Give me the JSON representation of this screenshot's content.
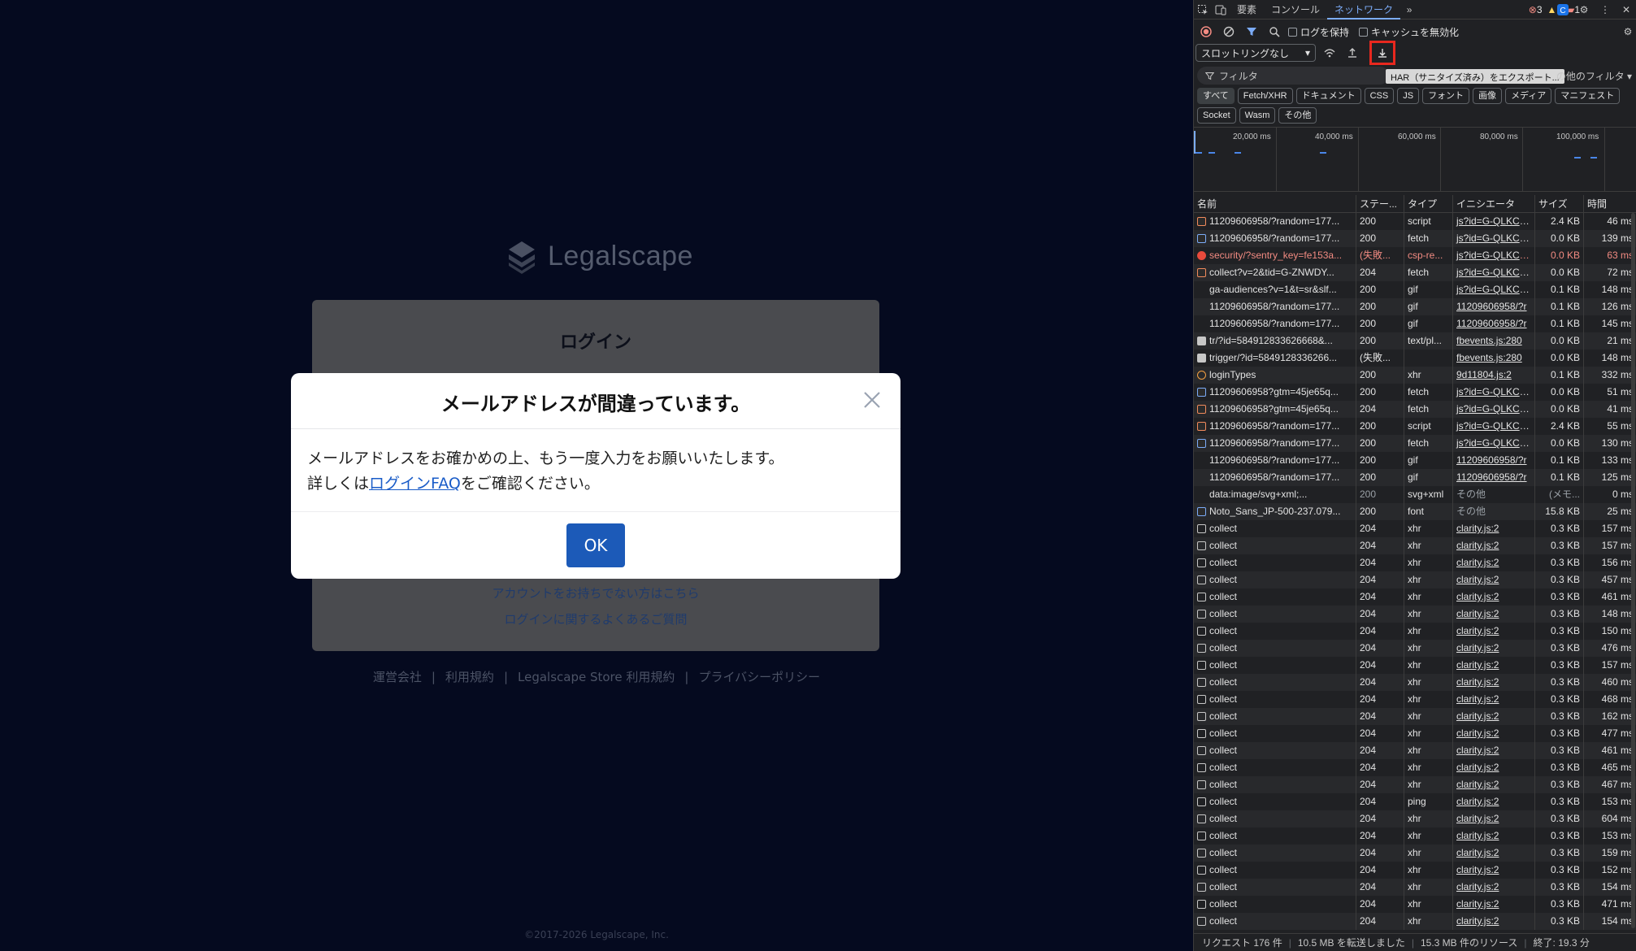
{
  "page": {
    "logo_text": "Legalscape",
    "login_title": "ログイン",
    "link_no_account": "アカウントをお持ちでない方はこちら",
    "link_login_faq": "ログインに関するよくあるご質問",
    "footer_links": [
      "運営会社",
      "利用規約",
      "Legalscape Store 利用規約",
      "プライバシーポリシー"
    ],
    "copyright": "©2017-2026 Legalscape, Inc."
  },
  "modal": {
    "title": "メールアドレスが間違っています。",
    "line1": "メールアドレスをお確かめの上、もう一度入力をお願いいたします。",
    "line2_prefix": "詳しくは",
    "line2_link": "ログインFAQ",
    "line2_suffix": "をご確認ください。",
    "ok_label": "OK"
  },
  "devtools": {
    "tabs": [
      "要素",
      "コンソール",
      "ネットワーク"
    ],
    "active_tab": "ネットワーク",
    "errors": "3",
    "warnings": "1",
    "issues": "1",
    "preserve_log": "ログを保持",
    "disable_cache": "キャッシュを無効化",
    "throttling": "スロットリングなし",
    "filter_placeholder": "フィルタ",
    "tooltip": "HAR（サニタイズ済み）をエクスポート...",
    "more_filters": "の他のフィルタ",
    "type_filters": [
      "すべて",
      "Fetch/XHR",
      "ドキュメント",
      "CSS",
      "JS",
      "フォント",
      "画像",
      "メディア",
      "マニフェスト",
      "Socket",
      "Wasm",
      "その他"
    ],
    "overview_labels": [
      "20,000 ms",
      "40,000 ms",
      "60,000 ms",
      "80,000 ms",
      "100,000 ms"
    ],
    "columns": [
      "名前",
      "ステー...",
      "タイプ",
      "イニシエータ",
      "サイズ",
      "時間"
    ],
    "status_bar": [
      "リクエスト 176 件",
      "10.5 MB を転送しました",
      "15.3 MB 件のリソース",
      "終了: 19.3 分"
    ],
    "accent_color": "#7cacf8",
    "highlight_color": "#e8281e"
  },
  "requests": [
    {
      "name": "11209606958/?random=177...",
      "status": "200",
      "type": "script",
      "initiator": "js?id=G-QLKCPG",
      "size": "2.4 KB",
      "time": "46 ms",
      "icon": "script"
    },
    {
      "name": "11209606958/?random=177...",
      "status": "200",
      "type": "fetch",
      "initiator": "js?id=G-QLKCPG",
      "size": "0.0 KB",
      "time": "139 ms",
      "icon": "fetch"
    },
    {
      "name": "security/?sentry_key=fe153a...",
      "status": "(失敗...",
      "type": "csp-re...",
      "initiator": "js?id=G-QLKCPG",
      "size": "0.0 KB",
      "time": "63 ms",
      "icon": "error"
    },
    {
      "name": "collect?v=2&tid=G-ZNWDY...",
      "status": "204",
      "type": "fetch",
      "initiator": "js?id=G-QLKCPG",
      "size": "0.0 KB",
      "time": "72 ms",
      "icon": "script"
    },
    {
      "name": "ga-audiences?v=1&t=sr&slf...",
      "status": "200",
      "type": "gif",
      "initiator": "js?id=G-QLKCPG",
      "size": "0.1 KB",
      "time": "148 ms",
      "icon": "none"
    },
    {
      "name": "11209606958/?random=177...",
      "status": "200",
      "type": "gif",
      "initiator": "11209606958/?r",
      "size": "0.1 KB",
      "time": "126 ms",
      "icon": "none"
    },
    {
      "name": "11209606958/?random=177...",
      "status": "200",
      "type": "gif",
      "initiator": "11209606958/?r",
      "size": "0.1 KB",
      "time": "145 ms",
      "icon": "none"
    },
    {
      "name": "tr/?id=584912833626668&...",
      "status": "200",
      "type": "text/pl...",
      "initiator": "fbevents.js:280",
      "size": "0.0 KB",
      "time": "21 ms",
      "icon": "doc"
    },
    {
      "name": "trigger/?id=5849128336266...",
      "status": "(失敗...",
      "type": "",
      "initiator": "fbevents.js:280",
      "size": "0.0 KB",
      "time": "148 ms",
      "icon": "doc"
    },
    {
      "name": "loginTypes",
      "status": "200",
      "type": "xhr",
      "initiator": "9d11804.js:2",
      "size": "0.1 KB",
      "time": "332 ms",
      "icon": "xhr"
    },
    {
      "name": "11209606958?gtm=45je65q...",
      "status": "200",
      "type": "fetch",
      "initiator": "js?id=G-QLKCPG",
      "size": "0.0 KB",
      "time": "51 ms",
      "icon": "fetch"
    },
    {
      "name": "11209606958?gtm=45je65q...",
      "status": "204",
      "type": "fetch",
      "initiator": "js?id=G-QLKCPG",
      "size": "0.0 KB",
      "time": "41 ms",
      "icon": "script"
    },
    {
      "name": "11209606958/?random=177...",
      "status": "200",
      "type": "script",
      "initiator": "js?id=G-QLKCPG",
      "size": "2.4 KB",
      "time": "55 ms",
      "icon": "script"
    },
    {
      "name": "11209606958/?random=177...",
      "status": "200",
      "type": "fetch",
      "initiator": "js?id=G-QLKCPG",
      "size": "0.0 KB",
      "time": "130 ms",
      "icon": "fetch"
    },
    {
      "name": "11209606958/?random=177...",
      "status": "200",
      "type": "gif",
      "initiator": "11209606958/?r",
      "size": "0.1 KB",
      "time": "133 ms",
      "icon": "none"
    },
    {
      "name": "11209606958/?random=177...",
      "status": "200",
      "type": "gif",
      "initiator": "11209606958/?r",
      "size": "0.1 KB",
      "time": "125 ms",
      "icon": "none"
    },
    {
      "name": "data:image/svg+xml;...",
      "status": "200",
      "type": "svg+xml",
      "initiator": "その他",
      "size": "(メモ...",
      "time": "0 ms",
      "icon": "svg",
      "muted": true
    },
    {
      "name": "Noto_Sans_JP-500-237.079...",
      "status": "200",
      "type": "font",
      "initiator": "その他",
      "size": "15.8 KB",
      "time": "25 ms",
      "icon": "font"
    },
    {
      "name": "collect",
      "status": "204",
      "type": "xhr",
      "initiator": "clarity.js:2",
      "size": "0.3 KB",
      "time": "157 ms",
      "icon": "plain"
    },
    {
      "name": "collect",
      "status": "204",
      "type": "xhr",
      "initiator": "clarity.js:2",
      "size": "0.3 KB",
      "time": "157 ms",
      "icon": "plain"
    },
    {
      "name": "collect",
      "status": "204",
      "type": "xhr",
      "initiator": "clarity.js:2",
      "size": "0.3 KB",
      "time": "156 ms",
      "icon": "plain"
    },
    {
      "name": "collect",
      "status": "204",
      "type": "xhr",
      "initiator": "clarity.js:2",
      "size": "0.3 KB",
      "time": "457 ms",
      "icon": "plain"
    },
    {
      "name": "collect",
      "status": "204",
      "type": "xhr",
      "initiator": "clarity.js:2",
      "size": "0.3 KB",
      "time": "461 ms",
      "icon": "plain"
    },
    {
      "name": "collect",
      "status": "204",
      "type": "xhr",
      "initiator": "clarity.js:2",
      "size": "0.3 KB",
      "time": "148 ms",
      "icon": "plain"
    },
    {
      "name": "collect",
      "status": "204",
      "type": "xhr",
      "initiator": "clarity.js:2",
      "size": "0.3 KB",
      "time": "150 ms",
      "icon": "plain"
    },
    {
      "name": "collect",
      "status": "204",
      "type": "xhr",
      "initiator": "clarity.js:2",
      "size": "0.3 KB",
      "time": "476 ms",
      "icon": "plain"
    },
    {
      "name": "collect",
      "status": "204",
      "type": "xhr",
      "initiator": "clarity.js:2",
      "size": "0.3 KB",
      "time": "157 ms",
      "icon": "plain"
    },
    {
      "name": "collect",
      "status": "204",
      "type": "xhr",
      "initiator": "clarity.js:2",
      "size": "0.3 KB",
      "time": "460 ms",
      "icon": "plain"
    },
    {
      "name": "collect",
      "status": "204",
      "type": "xhr",
      "initiator": "clarity.js:2",
      "size": "0.3 KB",
      "time": "468 ms",
      "icon": "plain"
    },
    {
      "name": "collect",
      "status": "204",
      "type": "xhr",
      "initiator": "clarity.js:2",
      "size": "0.3 KB",
      "time": "162 ms",
      "icon": "plain"
    },
    {
      "name": "collect",
      "status": "204",
      "type": "xhr",
      "initiator": "clarity.js:2",
      "size": "0.3 KB",
      "time": "477 ms",
      "icon": "plain"
    },
    {
      "name": "collect",
      "status": "204",
      "type": "xhr",
      "initiator": "clarity.js:2",
      "size": "0.3 KB",
      "time": "461 ms",
      "icon": "plain"
    },
    {
      "name": "collect",
      "status": "204",
      "type": "xhr",
      "initiator": "clarity.js:2",
      "size": "0.3 KB",
      "time": "465 ms",
      "icon": "plain"
    },
    {
      "name": "collect",
      "status": "204",
      "type": "xhr",
      "initiator": "clarity.js:2",
      "size": "0.3 KB",
      "time": "467 ms",
      "icon": "plain"
    },
    {
      "name": "collect",
      "status": "204",
      "type": "ping",
      "initiator": "clarity.js:2",
      "size": "0.3 KB",
      "time": "153 ms",
      "icon": "plain"
    },
    {
      "name": "collect",
      "status": "204",
      "type": "xhr",
      "initiator": "clarity.js:2",
      "size": "0.3 KB",
      "time": "604 ms",
      "icon": "plain"
    },
    {
      "name": "collect",
      "status": "204",
      "type": "xhr",
      "initiator": "clarity.js:2",
      "size": "0.3 KB",
      "time": "153 ms",
      "icon": "plain"
    },
    {
      "name": "collect",
      "status": "204",
      "type": "xhr",
      "initiator": "clarity.js:2",
      "size": "0.3 KB",
      "time": "159 ms",
      "icon": "plain"
    },
    {
      "name": "collect",
      "status": "204",
      "type": "xhr",
      "initiator": "clarity.js:2",
      "size": "0.3 KB",
      "time": "152 ms",
      "icon": "plain"
    },
    {
      "name": "collect",
      "status": "204",
      "type": "xhr",
      "initiator": "clarity.js:2",
      "size": "0.3 KB",
      "time": "154 ms",
      "icon": "plain"
    },
    {
      "name": "collect",
      "status": "204",
      "type": "xhr",
      "initiator": "clarity.js:2",
      "size": "0.3 KB",
      "time": "471 ms",
      "icon": "plain"
    },
    {
      "name": "collect",
      "status": "204",
      "type": "xhr",
      "initiator": "clarity.js:2",
      "size": "0.3 KB",
      "time": "154 ms",
      "icon": "plain"
    }
  ]
}
